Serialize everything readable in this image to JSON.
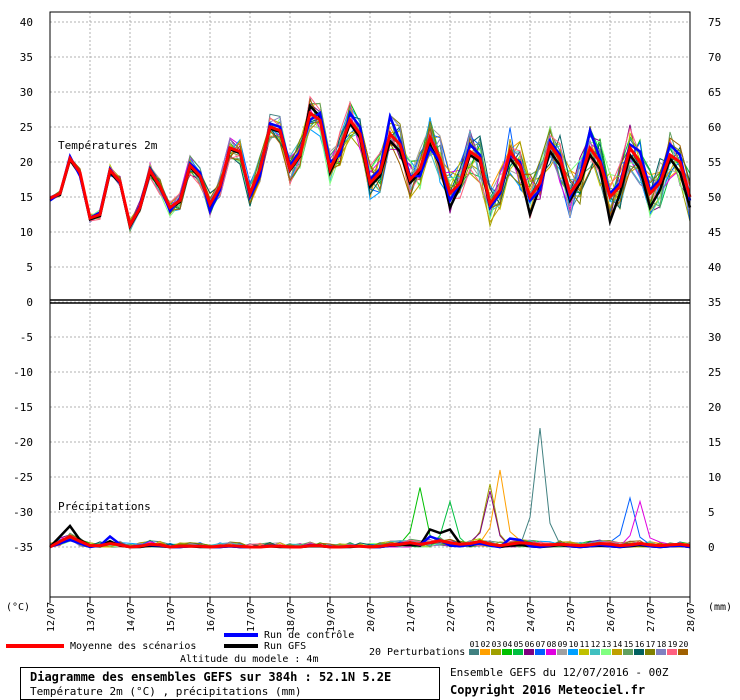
{
  "chart_data": {
    "type": "line",
    "x_dates": [
      "12/07",
      "13/07",
      "14/07",
      "15/07",
      "16/07",
      "17/07",
      "18/07",
      "19/07",
      "20/07",
      "21/07",
      "22/07",
      "23/07",
      "24/07",
      "25/07",
      "26/07",
      "27/07",
      "28/07"
    ],
    "left_axis_ticks": [
      40,
      35,
      30,
      25,
      20,
      15,
      10,
      5,
      0,
      -5,
      -10,
      -15,
      -20,
      -25,
      -30,
      -35
    ],
    "right_axis_ticks": [
      75,
      70,
      65,
      60,
      55,
      50,
      45,
      40,
      35,
      30,
      25,
      20,
      15,
      10,
      5,
      0
    ],
    "left_unit": "(°C)",
    "right_unit": "(mm)",
    "temperature_label": "Températures 2m",
    "precip_label": "Précipitations",
    "temperature": {
      "mean": [
        14.8,
        15.5,
        20.5,
        18.5,
        12.0,
        12.5,
        18.8,
        17.2,
        11.0,
        13.5,
        18.8,
        16.5,
        13.5,
        14.5,
        19.5,
        18.0,
        14.0,
        16.5,
        22.0,
        21.5,
        15.5,
        19.0,
        25.0,
        24.5,
        19.0,
        21.0,
        27.0,
        26.0,
        19.0,
        22.0,
        26.0,
        24.0,
        17.0,
        18.5,
        24.0,
        22.5,
        17.5,
        19.0,
        23.5,
        20.5,
        15.5,
        17.0,
        21.5,
        20.5,
        14.0,
        16.0,
        21.5,
        19.5,
        15.0,
        17.0,
        22.5,
        20.5,
        15.5,
        17.5,
        22.0,
        20.0,
        15.0,
        16.5,
        22.0,
        20.0,
        15.5,
        17.0,
        21.0,
        20.0,
        15.0
      ],
      "control": [
        14.5,
        15.5,
        20.8,
        18.0,
        12.0,
        12.8,
        19.0,
        17.0,
        11.0,
        13.8,
        19.0,
        16.5,
        13.0,
        14.8,
        19.8,
        18.5,
        13.0,
        16.0,
        22.0,
        21.5,
        15.0,
        18.0,
        25.5,
        25.0,
        19.5,
        21.5,
        26.0,
        27.0,
        20.0,
        21.0,
        27.0,
        25.0,
        17.5,
        19.0,
        26.5,
        23.0,
        18.0,
        18.0,
        22.0,
        20.0,
        14.5,
        17.0,
        22.5,
        21.0,
        13.5,
        15.5,
        21.0,
        20.0,
        14.5,
        16.0,
        23.0,
        21.0,
        15.0,
        18.0,
        24.5,
        20.5,
        15.5,
        17.0,
        22.5,
        21.5,
        16.0,
        17.5,
        22.5,
        21.0,
        14.5
      ],
      "gfs": [
        14.8,
        15.3,
        20.3,
        18.2,
        11.8,
        12.3,
        18.5,
        17.0,
        10.8,
        13.3,
        18.5,
        16.3,
        13.3,
        14.3,
        19.3,
        17.8,
        13.8,
        16.3,
        21.8,
        21.3,
        15.3,
        18.8,
        24.8,
        24.3,
        18.8,
        20.8,
        28.0,
        26.5,
        18.5,
        21.5,
        25.5,
        23.5,
        16.5,
        18.0,
        23.0,
        21.5,
        17.0,
        18.5,
        22.5,
        19.5,
        13.5,
        16.5,
        21.0,
        20.0,
        13.5,
        15.5,
        20.5,
        18.5,
        12.5,
        16.5,
        21.5,
        19.5,
        14.5,
        17.0,
        21.0,
        19.0,
        11.5,
        15.5,
        21.0,
        19.0,
        13.5,
        16.0,
        20.5,
        18.5,
        13.5
      ]
    },
    "precipitation_mm": {
      "mean": [
        0,
        0.8,
        1.5,
        0.8,
        0.2,
        0.2,
        0.5,
        0.3,
        0,
        0.1,
        0.4,
        0.3,
        0,
        0.1,
        0.1,
        0.1,
        0,
        0.1,
        0.2,
        0.1,
        0,
        0,
        0.1,
        0.1,
        0,
        0,
        0.2,
        0.2,
        0,
        0,
        0.1,
        0.1,
        0,
        0.1,
        0.3,
        0.4,
        0.6,
        0.4,
        0.6,
        0.9,
        0.6,
        0.4,
        0.5,
        0.8,
        0.4,
        0.2,
        0.4,
        0.6,
        0.5,
        0.3,
        0.3,
        0.4,
        0.3,
        0.2,
        0.3,
        0.5,
        0.4,
        0.2,
        0.3,
        0.5,
        0.3,
        0.2,
        0.3,
        0.4,
        0.2
      ],
      "control": [
        0,
        0.5,
        1.0,
        0.5,
        0,
        0.2,
        1.5,
        0.4,
        0,
        0.2,
        0.3,
        0.2,
        0,
        0,
        0.1,
        0.1,
        0,
        0,
        0.1,
        0,
        0,
        0,
        0.2,
        0.1,
        0,
        0,
        0.3,
        0.2,
        0,
        0,
        0.1,
        0.1,
        0,
        0,
        0.2,
        0.5,
        0.6,
        0.3,
        1.5,
        1.0,
        0.2,
        0.1,
        0.3,
        0.5,
        0.2,
        0,
        1.2,
        1.0,
        0.1,
        0,
        0.2,
        0.5,
        0.1,
        0,
        0.1,
        0.3,
        0.1,
        0,
        0.2,
        0.4,
        0.1,
        0,
        0.1,
        0.2,
        0
      ],
      "gfs": [
        0,
        1.5,
        3.0,
        1.0,
        0.2,
        0.1,
        0.8,
        0.2,
        0,
        0,
        0.2,
        0.1,
        0,
        0,
        0.1,
        0,
        0,
        0,
        0.1,
        0,
        0,
        0,
        0.1,
        0,
        0,
        0,
        0.1,
        0.1,
        0,
        0,
        0,
        0.1,
        0,
        0,
        0.2,
        0.3,
        0.3,
        0.2,
        2.5,
        2.0,
        2.5,
        0.5,
        0.2,
        0.6,
        0.3,
        0,
        0.2,
        0.3,
        0.1,
        0,
        0.1,
        0.3,
        0.1,
        0,
        0.1,
        0.2,
        0.1,
        0,
        0.1,
        0.3,
        0.1,
        0,
        0.1,
        0.2,
        0
      ],
      "notable_peaks": [
        {
          "date_index": 48.5,
          "value": 17.0
        },
        {
          "date_index": 45.0,
          "value": 11.0
        },
        {
          "date_index": 43.5,
          "value": 9.0
        },
        {
          "date_index": 37.0,
          "value": 8.5
        },
        {
          "date_index": 39.5,
          "value": 6.5
        },
        {
          "date_index": 44.0,
          "value": 8.0
        },
        {
          "date_index": 57.5,
          "value": 7.0
        },
        {
          "date_index": 58.5,
          "value": 6.5
        }
      ]
    },
    "legend": {
      "mean": "Moyenne des scénarios",
      "control": "Run de contrôle",
      "gfs": "Run GFS",
      "perturbations": "20 Perturbations",
      "perturbation_numbers": [
        "01",
        "02",
        "03",
        "04",
        "05",
        "06",
        "07",
        "08",
        "09",
        "10",
        "11",
        "12",
        "13",
        "14",
        "15",
        "16",
        "17",
        "18",
        "19",
        "20"
      ]
    }
  },
  "colors": {
    "mean": "#ff0000",
    "control": "#0000ff",
    "gfs": "#000000",
    "perturbations": [
      "#408080",
      "#ffa000",
      "#a0a000",
      "#00c000",
      "#00c040",
      "#800080",
      "#0060ff",
      "#e000e0",
      "#a0a0a0",
      "#00a0ff",
      "#c0c000",
      "#40c0c0",
      "#80ff80",
      "#c0a000",
      "#60a060",
      "#006060",
      "#808000",
      "#8080c0",
      "#ff6080",
      "#a06000"
    ]
  },
  "info": {
    "altitude": "Altitude du modele : 4m",
    "title": "Diagramme des ensembles GEFS sur 384h : 52.1N 5.2E",
    "subtitle": "Température 2m (°C) , précipitations (mm)",
    "ensemble": "Ensemble GEFS du 12/07/2016 - 00Z",
    "copyright": "Copyright 2016 Meteociel.fr"
  }
}
